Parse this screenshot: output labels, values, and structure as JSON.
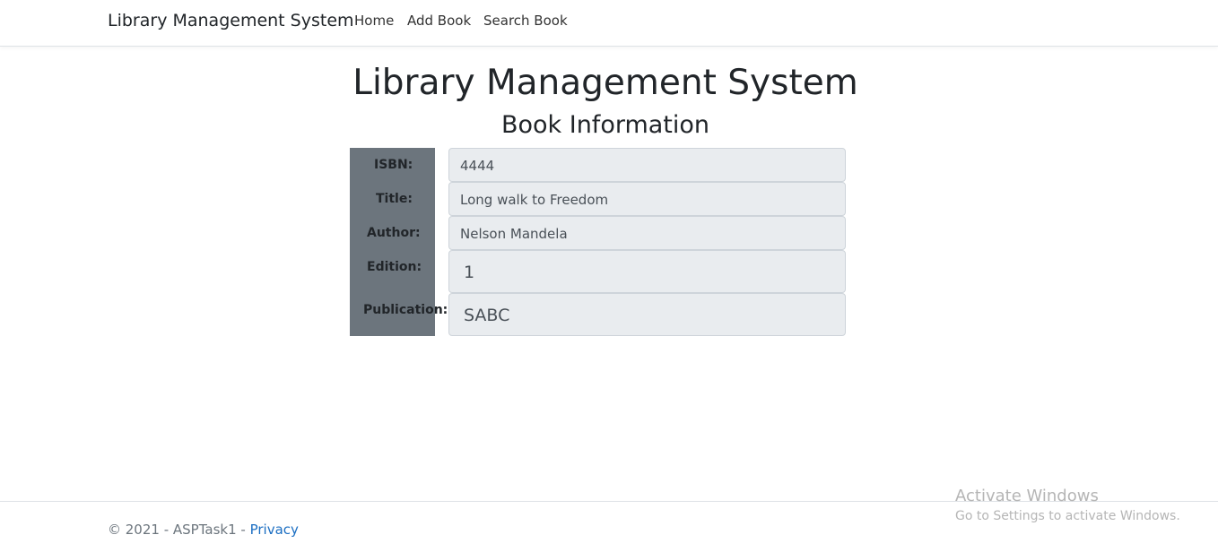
{
  "navbar": {
    "brand": "Library Management System",
    "links": [
      {
        "label": "Home"
      },
      {
        "label": "Add Book"
      },
      {
        "label": "Search Book"
      }
    ]
  },
  "main": {
    "title": "Library Management System",
    "subtitle": "Book Information"
  },
  "book": {
    "fields": [
      {
        "label": "ISBN:",
        "value": "4444"
      },
      {
        "label": "Title:",
        "value": "Long walk to Freedom"
      },
      {
        "label": "Author:",
        "value": "Nelson Mandela"
      },
      {
        "label": "Edition:",
        "value": "1"
      },
      {
        "label": "Publication:",
        "value": "SABC"
      }
    ]
  },
  "footer": {
    "copyright": "© 2021 - ASPTask1 - ",
    "privacy_label": "Privacy"
  },
  "watermark": {
    "title": "Activate Windows",
    "subtitle": "Go to Settings to activate Windows."
  },
  "colors": {
    "label_column_bg": "#6c757d",
    "field_bg": "#e9ecef",
    "link": "#1b6ec2"
  }
}
